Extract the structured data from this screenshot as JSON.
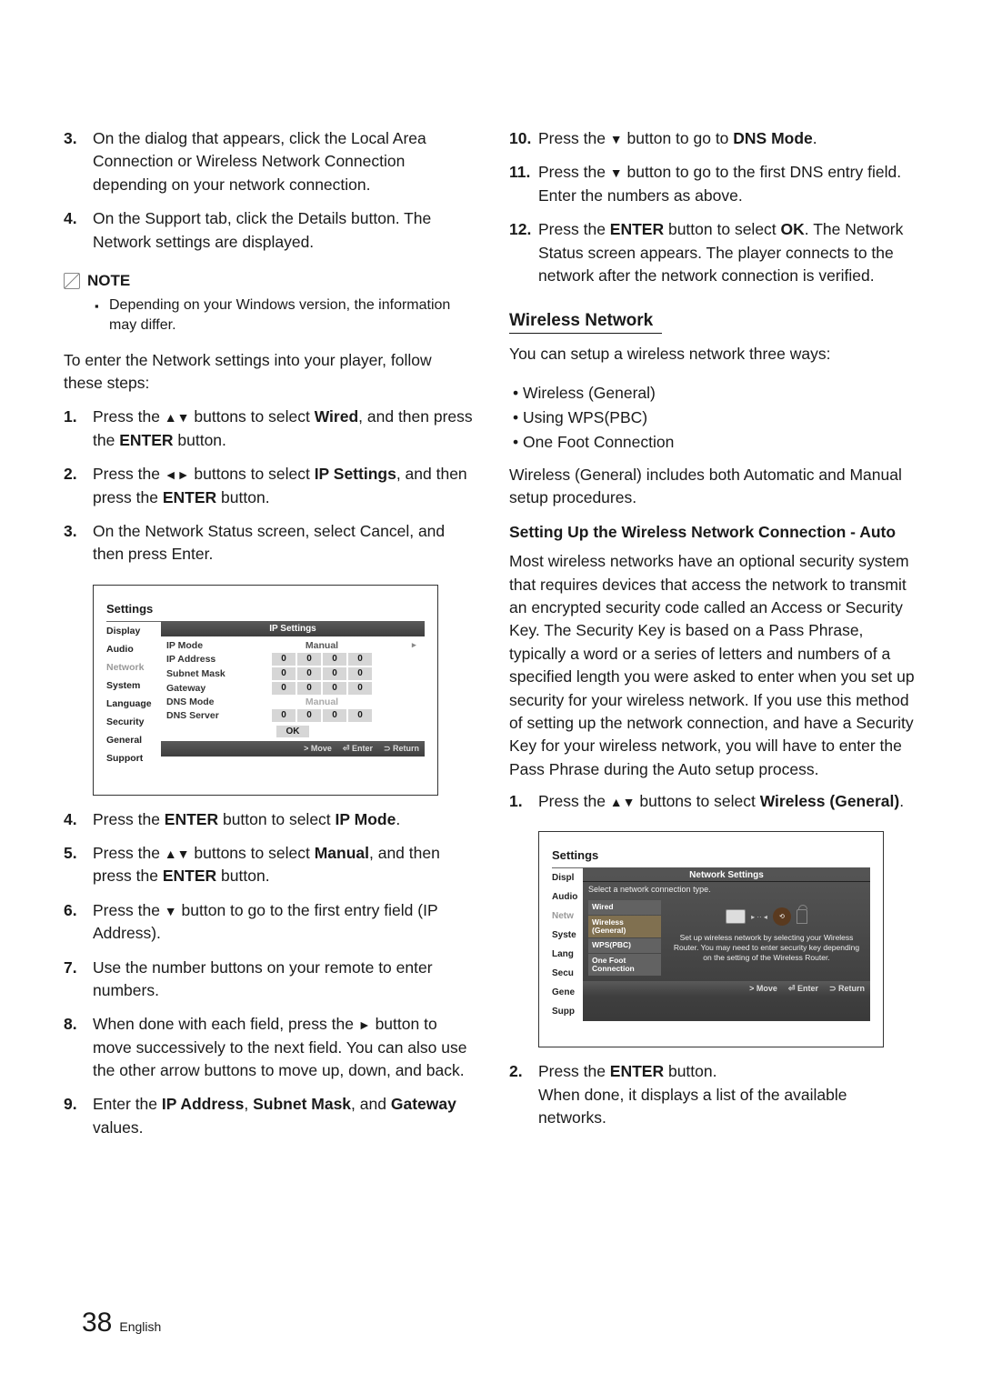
{
  "left": {
    "step3": {
      "num": "3.",
      "text": "On the dialog that appears, click the Local Area Connection or Wireless Network Connection depending on your network connection."
    },
    "step4a": {
      "num": "4.",
      "text": "On the Support tab, click the Details button. The Network settings are displayed."
    },
    "note_label": "NOTE",
    "note_item": "Depending on your Windows version, the information may differ.",
    "intro": "To enter the Network settings into your player, follow these steps:",
    "steps": [
      {
        "num": "1.",
        "pre": "Press the ",
        "btns": "▲▼",
        "mid": " buttons to select ",
        "bold": "Wired",
        "post": ", and then press the ",
        "bold2": "ENTER",
        "end": " button."
      },
      {
        "num": "2.",
        "pre": "Press the ",
        "btns": "◄►",
        "mid": " buttons to select ",
        "bold": "IP Settings",
        "post": ", and then press the ",
        "bold2": "ENTER",
        "end": " button."
      },
      {
        "num": "3.",
        "text": "On the Network Status screen, select Cancel, and then press Enter."
      }
    ],
    "panel": {
      "title": "Settings",
      "hdr": "IP Settings",
      "side": [
        "Display",
        "Audio",
        "Network",
        "System",
        "Language",
        "Security",
        "General",
        "Support"
      ],
      "rows": [
        {
          "label": "IP Mode",
          "type": "text",
          "value": "Manual"
        },
        {
          "label": "IP Address",
          "type": "nums",
          "values": [
            "0",
            "0",
            "0",
            "0"
          ]
        },
        {
          "label": "Subnet Mask",
          "type": "nums",
          "values": [
            "0",
            "0",
            "0",
            "0"
          ]
        },
        {
          "label": "Gateway",
          "type": "nums",
          "values": [
            "0",
            "0",
            "0",
            "0"
          ]
        },
        {
          "label": "DNS Mode",
          "type": "text",
          "value": "Manual",
          "dim": true
        },
        {
          "label": "DNS Server",
          "type": "nums",
          "values": [
            "0",
            "0",
            "0",
            "0"
          ]
        }
      ],
      "ok": "OK",
      "footer": [
        "> Move",
        "⏎ Enter",
        "⊃ Return"
      ]
    },
    "steps2": [
      {
        "num": "4.",
        "pre": "Press the ",
        "bold": "ENTER",
        "mid": " button to select ",
        "bold2": "IP Mode",
        "end": "."
      },
      {
        "num": "5.",
        "pre": "Press the ",
        "btns": "▲▼",
        "mid": " buttons to select ",
        "bold": "Manual",
        "post": ", and then press the ",
        "bold2": "ENTER",
        "end": " button."
      },
      {
        "num": "6.",
        "pre": "Press the ",
        "btns": "▼",
        "mid": " button to go to the first entry field (IP Address)."
      },
      {
        "num": "7.",
        "text": "Use the number buttons on your remote to enter numbers."
      },
      {
        "num": "8.",
        "pre": "When done with each field, press the ",
        "btns": "►",
        "mid": " button to move successively to the next field. You can also use the other arrow buttons to move up, down, and back."
      },
      {
        "num": "9.",
        "pre": "Enter the ",
        "b1": "IP Address",
        "c1": ", ",
        "b2": "Subnet Mask",
        "c2": ", and ",
        "b3": "Gateway",
        "end": " values."
      }
    ]
  },
  "right": {
    "steps_top": [
      {
        "num": "10.",
        "pre": "Press the ",
        "btns": "▼",
        "mid": " button to go to ",
        "bold": "DNS Mode",
        "end": "."
      },
      {
        "num": "11.",
        "pre": "Press the ",
        "btns": "▼",
        "mid": " button to go to the first DNS entry field. Enter the numbers as above."
      },
      {
        "num": "12.",
        "pre": "Press the ",
        "bold": "ENTER",
        "mid": " button to select ",
        "bold2": "OK",
        "post": ". The Network Status screen appears. The player connects to the network after the network connection is verified."
      }
    ],
    "section": "Wireless Network",
    "para1": "You can setup a wireless network three ways:",
    "bullets": [
      "Wireless (General)",
      "Using WPS(PBC)",
      "One Foot Connection"
    ],
    "para2": "Wireless (General) includes both Automatic and Manual setup procedures.",
    "subhead": "Setting Up the Wireless Network Connection - Auto",
    "para3": "Most wireless networks have an optional security system that requires devices that access the network to transmit an encrypted security code called an Access or Security Key. The Security Key is based on a Pass Phrase, typically a word or a series of letters and numbers of a specified length you were asked to enter when you set up security for your wireless network. If you use this method of setting up the network connection, and have a Security Key for your wireless network, you will have to enter the Pass Phrase during the Auto setup process.",
    "step_r1": {
      "num": "1.",
      "pre": "Press the ",
      "btns": "▲▼",
      "mid": " buttons to select ",
      "bold": "Wireless (General)",
      "end": "."
    },
    "panel": {
      "title": "Settings",
      "hdr": "Network Settings",
      "sub": "Select a network connection type.",
      "side": [
        "Displ",
        "Audio",
        "Netw",
        "Syste",
        "Lang",
        "Secu",
        "Gene",
        "Supp"
      ],
      "list": [
        "Wired",
        "Wireless (General)",
        "WPS(PBC)",
        "One Foot Connection"
      ],
      "desc": "Set up wireless network by selecting your Wireless Router. You may need to enter security key depending on the setting of the Wireless Router.",
      "footer": [
        "> Move",
        "⏎ Enter",
        "⊃ Return"
      ]
    },
    "step_r2": {
      "num": "2.",
      "pre": "Press the ",
      "bold": "ENTER",
      "mid": " button.",
      "line2": "When done, it displays a list of the available networks."
    }
  },
  "footer": {
    "page": "38",
    "lang": "English"
  }
}
